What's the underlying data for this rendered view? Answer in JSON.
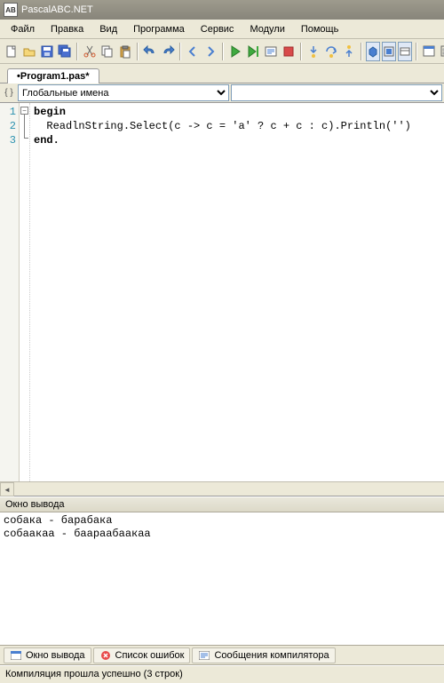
{
  "app": {
    "title": "PascalABC.NET"
  },
  "menu": {
    "file": "Файл",
    "edit": "Правка",
    "view": "Вид",
    "program": "Программа",
    "service": "Сервис",
    "modules": "Модули",
    "help": "Помощь"
  },
  "tab": {
    "label": "•Program1.pas*"
  },
  "combo": {
    "scope": "Глобальные имена"
  },
  "code": {
    "line1": "begin",
    "line2": "  ReadlnString.Select(c -> c = 'a' ? c + c : c).Println('')",
    "line3": "end.",
    "gutter": [
      "1",
      "2",
      "3"
    ]
  },
  "output": {
    "header": "Окно вывода",
    "line1": "собака - барабака",
    "line2": "собаакаа - баараабаакаа"
  },
  "bottomTabs": {
    "out": "Окно вывода",
    "errors": "Список ошибок",
    "compiler": "Сообщения компилятора"
  },
  "status": {
    "text": "Компиляция прошла успешно (3 строк)"
  }
}
